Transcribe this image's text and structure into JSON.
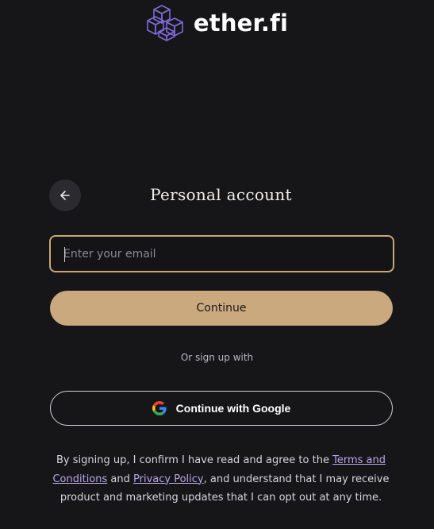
{
  "brand": {
    "name": "ether.fi",
    "logo_icon": "etherfi-cube-logo-icon",
    "accent_color": "#c9a97d",
    "link_color": "#b8a7e8"
  },
  "header": {
    "back_icon": "arrow-left-icon",
    "title": "Personal account"
  },
  "email": {
    "value": "",
    "placeholder": "Enter your email"
  },
  "continue_label": "Continue",
  "divider_text": "Or sign up with",
  "google": {
    "icon": "google-g-icon",
    "label": "Continue with Google"
  },
  "legal": {
    "prefix": "By signing up, I confirm I have read and agree to the ",
    "terms_link": "Terms and Conditions",
    "middle": " and ",
    "privacy_link": "Privacy Policy",
    "suffix": ", and understand that I may receive product and marketing updates that I can opt out at any time."
  }
}
